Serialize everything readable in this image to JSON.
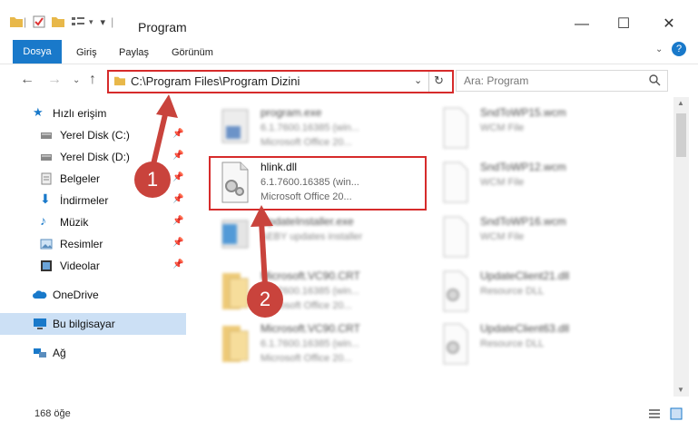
{
  "window": {
    "title": "Program"
  },
  "ribbon": {
    "tabs": [
      "Dosya",
      "Giriş",
      "Paylaş",
      "Görünüm"
    ]
  },
  "address": {
    "path": "C:\\Program Files\\Program Dizini"
  },
  "search": {
    "placeholder": "Ara: Program"
  },
  "sidebar": {
    "items": [
      {
        "label": "Hızlı erişim"
      },
      {
        "label": "Yerel Disk (C:)"
      },
      {
        "label": "Yerel Disk (D:)"
      },
      {
        "label": "Belgeler"
      },
      {
        "label": "İndirmeler"
      },
      {
        "label": "Müzik"
      },
      {
        "label": "Resimler"
      },
      {
        "label": "Videolar"
      },
      {
        "label": "OneDrive"
      },
      {
        "label": "Bu bilgisayar"
      },
      {
        "label": "Ağ"
      }
    ]
  },
  "files": {
    "col1": [
      {
        "name": "program.exe",
        "line1": "6.1.7600.16385 (win...",
        "line2": "Microsoft Office 20..."
      },
      {
        "name": "hlink.dll",
        "line1": "6.1.7600.16385 (win...",
        "line2": "Microsoft Office 20..."
      },
      {
        "name": "UpdateInstaller.exe",
        "line1": "AEBY updates installer",
        "line2": ""
      },
      {
        "name": "Microsoft.VC90.CRT",
        "line1": "6.1.7600.16385 (win...",
        "line2": "Microsoft Office 20..."
      },
      {
        "name": "Microsoft.VC90.CRT",
        "line1": "6.1.7600.16385 (win...",
        "line2": "Microsoft Office 20..."
      }
    ],
    "col2": [
      {
        "name": "SndToWP15.wcm",
        "line1": "WCM File"
      },
      {
        "name": "SndToWP12.wcm",
        "line1": "WCM File"
      },
      {
        "name": "SndToWP16.wcm",
        "line1": "WCM File"
      },
      {
        "name": "UpdateClient21.dll",
        "line1": "Resource DLL"
      },
      {
        "name": "UpdateClient63.dll",
        "line1": "Resource DLL"
      }
    ]
  },
  "status": {
    "count": "168 öğe"
  },
  "markers": {
    "one": "1",
    "two": "2"
  },
  "colors": {
    "accent": "#1979ca",
    "highlight": "#d62b2b",
    "marker": "#c9433c"
  }
}
